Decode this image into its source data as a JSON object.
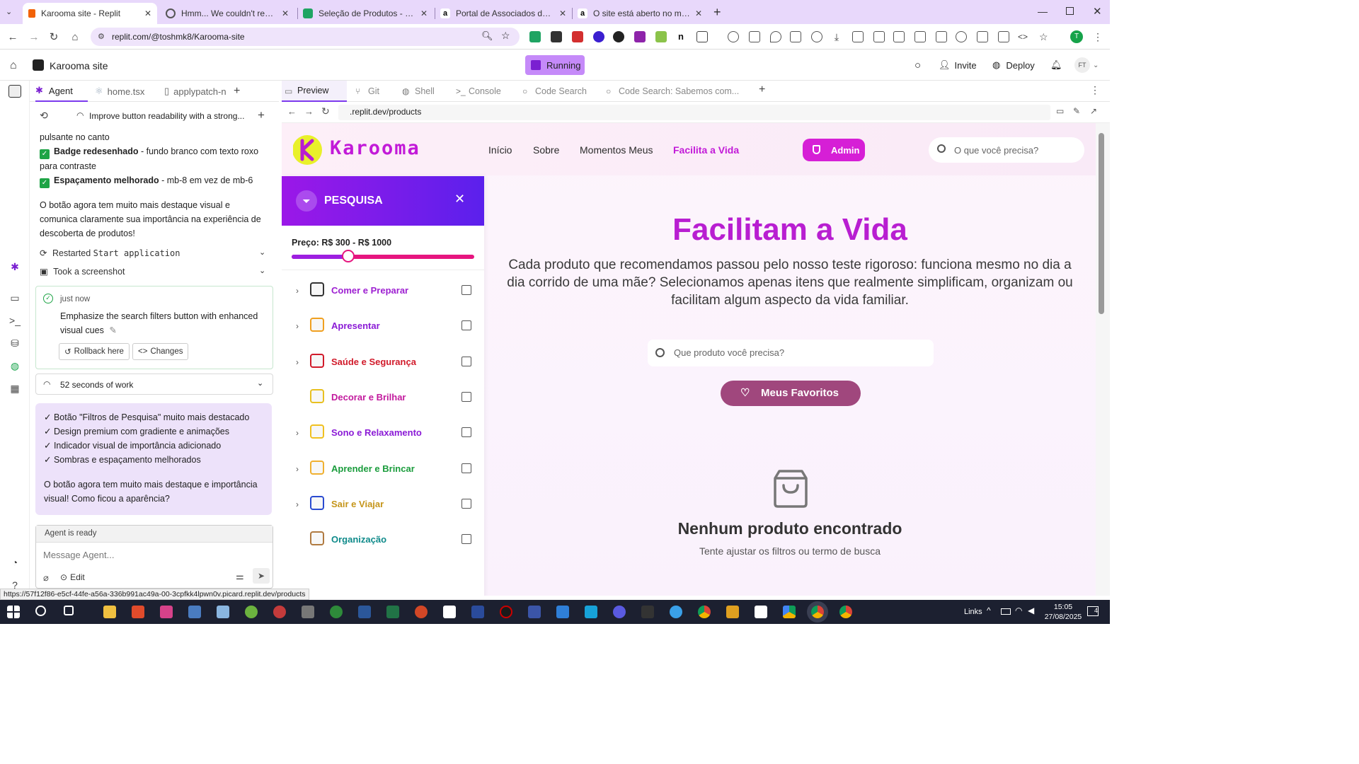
{
  "browser": {
    "tabs": [
      {
        "title": "Karooma site - Replit",
        "active": true
      },
      {
        "title": "Hmm... We couldn't reach this p"
      },
      {
        "title": "Seleção de Produtos - Planilhas"
      },
      {
        "title": "Portal de Associados da Amazo"
      },
      {
        "title": "O site está aberto no modo pro"
      }
    ],
    "url": "replit.com/@toshmk8/Karooma-site",
    "status_url": "https://57f12f86-e5cf-44fe-a56a-336b991ac49a-00-3cpfkk4lpwn0v.picard.replit.dev/products"
  },
  "replit": {
    "project_name": "Karooma site",
    "run_status": "Running",
    "invite_label": "Invite",
    "deploy_label": "Deploy",
    "avatar_initials": "FT",
    "left_tabs": [
      "Agent",
      "home.tsx",
      "applypatch-n"
    ],
    "thread_title": "Improve button readability with a strong...",
    "agent_messages": {
      "line_top": "pulsante no canto",
      "bullet1_bold": "Badge redesenhado",
      "bullet1_rest": " - fundo branco com texto roxo para contraste",
      "bullet2_bold": "Espaçamento melhorado",
      "bullet2_rest": " - mb-8 em vez de mb-6",
      "para": "O botão agora tem muito mais destaque visual e comunica claramente sua importância na experiência de descoberta de produtos!",
      "restarted_prefix": "Restarted",
      "restarted_code": "Start application",
      "screenshot": "Took a screenshot"
    },
    "checkpoint": {
      "time": "just now",
      "message": "Emphasize the search filters button with enhanced visual cues",
      "rollback_label": "Rollback here",
      "changes_label": "Changes"
    },
    "work_summary": "52 seconds of work",
    "summary_bullets": [
      "✓ Botão \"Filtros de Pesquisa\" muito mais destacado",
      "✓ Design premium com gradiente e animações",
      "✓ Indicador visual de importância adicionado",
      "✓ Sombras e espaçamento melhorados"
    ],
    "summary_footer": "O botão agora tem muito mais destaque e importância visual! Como ficou a aparência?",
    "agent_status": "Agent is ready",
    "message_placeholder": "Message Agent...",
    "edit_label": "Edit",
    "right_tabs": [
      "Preview",
      "Git",
      "Shell",
      "Console",
      "Code Search",
      "Code Search: Sabemos com..."
    ],
    "preview_url": ".replit.dev/products"
  },
  "site": {
    "brand": "Karooma",
    "nav": [
      "Início",
      "Sobre",
      "Momentos Meus",
      "Facilita a Vida"
    ],
    "admin_label": "Admin",
    "search_placeholder": "O que você precisa?",
    "filter_title": "PESQUISA",
    "price_label": "Preço: R$ 300 - R$ 1000",
    "price_slider_value": 0.31,
    "categories": [
      {
        "name": "Comer e Preparar",
        "color": "#9d1fd1",
        "icon": "pot-icon",
        "expandable": true
      },
      {
        "name": "Apresentar",
        "color": "#8b1bd6",
        "icon": "gift-icon",
        "expandable": true
      },
      {
        "name": "Saúde e Segurança",
        "color": "#d11a2a",
        "icon": "shield-icon",
        "expandable": true
      },
      {
        "name": "Decorar e Brilhar",
        "color": "#c21a9d",
        "icon": "sparkle-icon",
        "expandable": false
      },
      {
        "name": "Sono e Relaxamento",
        "color": "#8b1bd6",
        "icon": "sleep-icon",
        "expandable": true
      },
      {
        "name": "Aprender e Brincar",
        "color": "#1a9c3c",
        "icon": "palette-icon",
        "expandable": true
      },
      {
        "name": "Sair e Viajar",
        "color": "#c5951a",
        "icon": "plane-icon",
        "expandable": true
      },
      {
        "name": "Organização",
        "color": "#0f8a8a",
        "icon": "box-icon",
        "expandable": false
      }
    ],
    "hero_title": "Facilitam a Vida",
    "hero_text": "Cada produto que recomendamos passou pelo nosso teste rigoroso: funciona mesmo no dia a dia corrido de uma mãe? Selecionamos apenas itens que realmente simplificam, organizam ou facilitam algum aspecto da vida familiar.",
    "product_search_placeholder": "Que produto você precisa?",
    "favorites_label": "Meus Favoritos",
    "empty_title": "Nenhum produto encontrado",
    "empty_text": "Tente ajustar os filtros ou termo de busca",
    "colors": {
      "accent": "#c21ad8",
      "filter_gradient_start": "#9b18e8",
      "filter_gradient_end": "#5b20ec",
      "favorites": "#a0477d"
    }
  },
  "taskbar": {
    "links_label": "Links",
    "time": "15:05",
    "date": "27/08/2025",
    "notifications": "4"
  }
}
